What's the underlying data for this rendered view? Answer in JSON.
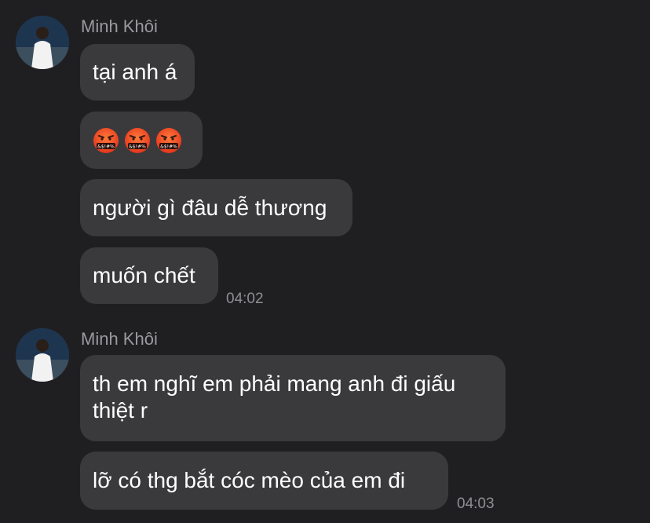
{
  "messages": [
    {
      "sender": "Minh Khôi",
      "items": [
        {
          "text": "tại anh á"
        },
        {
          "emoji": [
            "face-with-symbols-on-mouth",
            "face-with-symbols-on-mouth",
            "face-with-symbols-on-mouth"
          ]
        },
        {
          "text": "người gì đâu dễ thương"
        },
        {
          "text": "muốn chết",
          "time": "04:02"
        }
      ]
    },
    {
      "sender": "Minh Khôi",
      "items": [
        {
          "text": "th em nghĩ em phải mang anh đi giấu thiệt r"
        },
        {
          "text": "lỡ có thg bắt cóc mèo của em đi",
          "time": "04:03"
        }
      ]
    }
  ],
  "colors": {
    "background": "#1f1f21",
    "bubble": "#3a3a3c",
    "text": "#ffffff",
    "meta": "#8e8e93"
  }
}
